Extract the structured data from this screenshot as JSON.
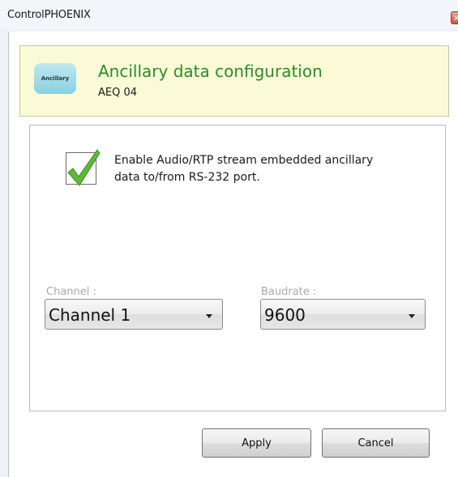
{
  "window": {
    "title": "ControlPHOENIX",
    "close_glyph": "x"
  },
  "header": {
    "badge_label": "Ancillary",
    "title": "Ancillary data configuration",
    "subtitle": "AEQ 04"
  },
  "options": {
    "enable_checkbox": {
      "checked": true,
      "label": "Enable Audio/RTP stream embedded ancillary data to/from RS-232 port."
    }
  },
  "channel": {
    "label": "Channel :",
    "value": "Channel 1"
  },
  "baudrate": {
    "label": "Baudrate :",
    "value": "9600"
  },
  "buttons": {
    "apply": "Apply",
    "cancel": "Cancel"
  },
  "colors": {
    "header_title": "#2f8a2c",
    "header_bg": "#fafad7",
    "check": "#5fb83a",
    "disabled_label": "#a9a9a9"
  },
  "icons": {
    "checkbox_mark": "check-icon",
    "dropdown": "chevron-down-icon",
    "close": "close-icon"
  }
}
